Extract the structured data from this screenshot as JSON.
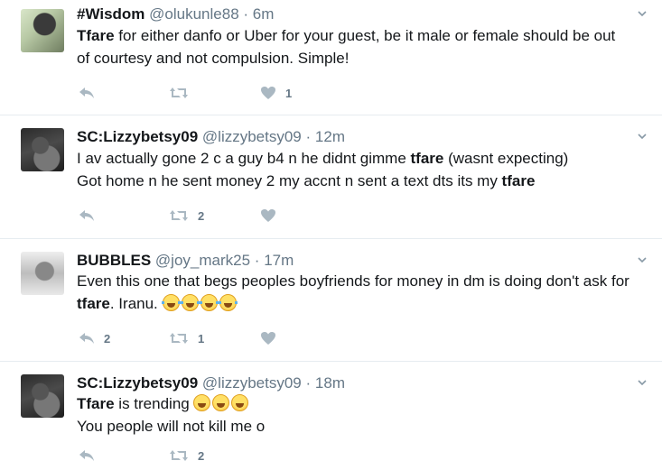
{
  "icons": {
    "reply": "reply-icon",
    "retweet": "retweet-icon",
    "like": "heart-icon",
    "more": "chevron-down-icon"
  },
  "colors": {
    "secondary_text": "#657786",
    "divider": "#e6ecf0",
    "primary_text": "#14171a"
  },
  "tweets": [
    {
      "name": "#Wisdom",
      "handle": "@olukunle88",
      "dot": "·",
      "time": "6m",
      "lines": [
        {
          "b": "Tfare",
          "t": " for either danfo or Uber for your guest, be it male or female should be out"
        },
        {
          "t": "of courtesy and not compulsion. Simple!"
        }
      ],
      "reply_count": "",
      "retweet_count": "",
      "like_count": "1"
    },
    {
      "name": "SC:Lizzybetsy09",
      "handle": "@lizzybetsy09",
      "dot": "·",
      "time": "12m",
      "lines": [
        {
          "t": "I av actually gone 2 c a guy b4 n he didnt gimme ",
          "b": "tfare",
          "t2": " (wasnt expecting)"
        },
        {
          "t": "Got home n he sent money 2 my accnt n sent a text dts its my ",
          "b": "tfare"
        }
      ],
      "reply_count": "",
      "retweet_count": "2",
      "like_count": ""
    },
    {
      "name": "BUBBLES",
      "handle": "@joy_mark25",
      "dot": "·",
      "time": "17m",
      "lines": [
        {
          "t": "Even this one that begs peoples boyfriends for money in dm is doing don't ask for"
        },
        {
          "b": "tfare",
          "t": ". Iranu."
        }
      ],
      "reply_count": "2",
      "retweet_count": "1",
      "like_count": ""
    },
    {
      "name": "SC:Lizzybetsy09",
      "handle": "@lizzybetsy09",
      "dot": "·",
      "time": "18m",
      "lines": [
        {
          "b": "Tfare",
          "t": " is trending "
        },
        {
          "t": "You people will not kill me o"
        }
      ],
      "reply_count": "",
      "retweet_count": "2",
      "like_count": ""
    }
  ]
}
